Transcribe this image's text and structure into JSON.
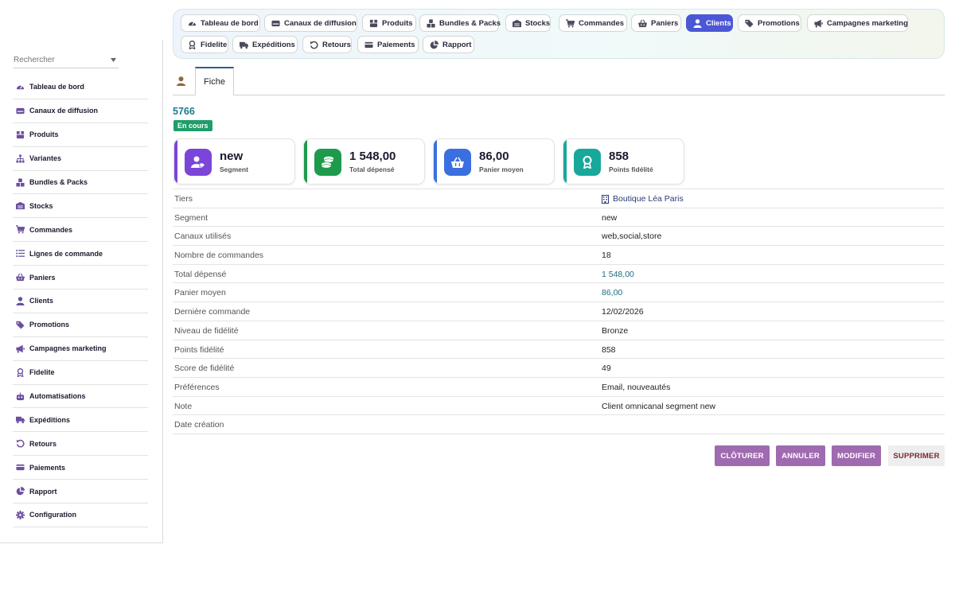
{
  "search": {
    "placeholder": "Rechercher"
  },
  "sidebar": {
    "items": [
      {
        "label": "Tableau de bord",
        "icon": "gauge-icon"
      },
      {
        "label": "Canaux de diffusion",
        "icon": "hdd-icon"
      },
      {
        "label": "Produits",
        "icon": "box-icon"
      },
      {
        "label": "Variantes",
        "icon": "sitemap-icon"
      },
      {
        "label": "Bundles & Packs",
        "icon": "cubes-icon"
      },
      {
        "label": "Stocks",
        "icon": "warehouse-icon"
      },
      {
        "label": "Commandes",
        "icon": "cart-icon"
      },
      {
        "label": "Lignes de commande",
        "icon": "list-icon"
      },
      {
        "label": "Paniers",
        "icon": "basket-icon"
      },
      {
        "label": "Clients",
        "icon": "user-icon"
      },
      {
        "label": "Promotions",
        "icon": "tags-icon"
      },
      {
        "label": "Campagnes marketing",
        "icon": "bullhorn-icon"
      },
      {
        "label": "Fidelite",
        "icon": "award-icon"
      },
      {
        "label": "Automatisations",
        "icon": "robot-icon"
      },
      {
        "label": "Expéditions",
        "icon": "truck-icon"
      },
      {
        "label": "Retours",
        "icon": "undo-icon"
      },
      {
        "label": "Paiements",
        "icon": "card-icon"
      },
      {
        "label": "Rapport",
        "icon": "pie-icon"
      },
      {
        "label": "Configuration",
        "icon": "gear-icon"
      }
    ]
  },
  "topnav": {
    "tabs": [
      {
        "label": "Tableau de bord",
        "icon": "gauge-icon"
      },
      {
        "label": "Canaux de diffusion",
        "icon": "hdd-icon"
      },
      {
        "label": "Produits",
        "icon": "box-icon"
      },
      {
        "label": "Bundles & Packs",
        "icon": "cubes-icon"
      },
      {
        "label": "Stocks",
        "icon": "warehouse-icon"
      },
      {
        "label": "Commandes",
        "icon": "cart-icon"
      },
      {
        "label": "Paniers",
        "icon": "basket-icon"
      },
      {
        "label": "Clients",
        "icon": "user-icon",
        "active": true
      },
      {
        "label": "Promotions",
        "icon": "tags-icon"
      },
      {
        "label": "Campagnes marketing",
        "icon": "bullhorn-icon"
      },
      {
        "label": "Fidelite",
        "icon": "award-icon"
      },
      {
        "label": "Expéditions",
        "icon": "truck-icon"
      },
      {
        "label": "Retours",
        "icon": "undo-icon"
      },
      {
        "label": "Paiements",
        "icon": "card-icon"
      },
      {
        "label": "Rapport",
        "icon": "pie-icon"
      }
    ]
  },
  "card": {
    "tab_label": "Fiche",
    "ref": "5766",
    "status": "En cours"
  },
  "kpis": [
    {
      "value": "new",
      "caption": "Segment",
      "color": "#7b45d9",
      "icon": "user-tag-icon"
    },
    {
      "value": "1 548,00",
      "caption": "Total dépensé",
      "color": "#1e9a4c",
      "icon": "coins-icon"
    },
    {
      "value": "86,00",
      "caption": "Panier moyen",
      "color": "#3a6fe0",
      "icon": "basket-icon"
    },
    {
      "value": "858",
      "caption": "Points fidélité",
      "color": "#18a89a",
      "icon": "award-icon"
    }
  ],
  "fields": [
    {
      "label": "Tiers",
      "value": "Boutique Léa Paris",
      "kind": "link"
    },
    {
      "label": "Segment",
      "value": "new"
    },
    {
      "label": "Canaux utilisés",
      "value": "web,social,store"
    },
    {
      "label": "Nombre de commandes",
      "value": "18"
    },
    {
      "label": "Total dépensé",
      "value": "1 548,00",
      "kind": "num"
    },
    {
      "label": "Panier moyen",
      "value": "86,00",
      "kind": "num"
    },
    {
      "label": "Dernière commande",
      "value": "12/02/2026"
    },
    {
      "label": "Niveau de fidélité",
      "value": "Bronze"
    },
    {
      "label": "Points fidélité",
      "value": "858"
    },
    {
      "label": "Score de fidélité",
      "value": "49"
    },
    {
      "label": "Préférences",
      "value": "Email, nouveautés"
    },
    {
      "label": "Note",
      "value": "Client omnicanal segment new"
    },
    {
      "label": "Date création",
      "value": ""
    }
  ],
  "actions": {
    "close": "CLÔTURER",
    "cancel": "ANNULER",
    "edit": "MODIFIER",
    "delete": "SUPPRIMER"
  }
}
